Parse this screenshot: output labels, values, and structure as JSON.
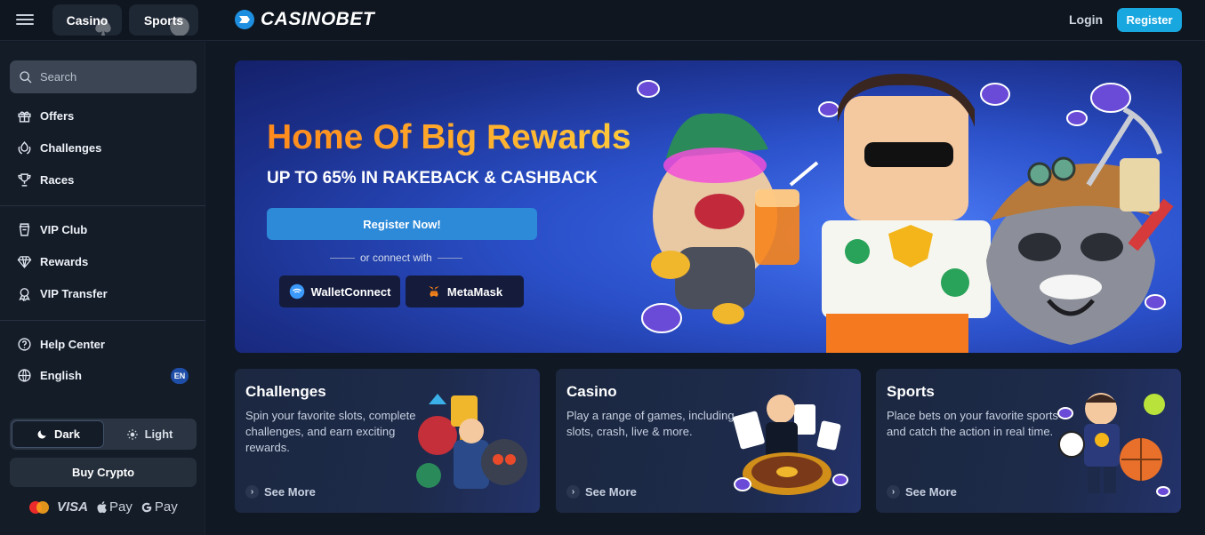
{
  "topbar": {
    "tabs": [
      {
        "label": "Casino"
      },
      {
        "label": "Sports"
      }
    ],
    "logo_text": "CASINOBET",
    "login_label": "Login",
    "register_label": "Register"
  },
  "sidebar": {
    "search_placeholder": "Search",
    "groups": [
      [
        {
          "label": "Offers",
          "icon": "gift-icon"
        },
        {
          "label": "Challenges",
          "icon": "challenges-icon"
        },
        {
          "label": "Races",
          "icon": "trophy-icon"
        }
      ],
      [
        {
          "label": "VIP Club",
          "icon": "vip-icon"
        },
        {
          "label": "Rewards",
          "icon": "diamond-icon"
        },
        {
          "label": "VIP Transfer",
          "icon": "transfer-icon"
        }
      ],
      [
        {
          "label": "Help Center",
          "icon": "help-icon"
        },
        {
          "label": "English",
          "icon": "globe-icon"
        }
      ]
    ],
    "language_badge": "EN",
    "theme": {
      "dark_label": "Dark",
      "light_label": "Light",
      "selected": "Dark"
    },
    "buy_crypto_label": "Buy Crypto",
    "payments": {
      "visa": "VISA",
      "apple_pay": "Pay",
      "google_pay": "Pay"
    }
  },
  "hero": {
    "title": "Home Of Big Rewards",
    "subtitle": "UP TO 65% IN RAKEBACK & CASHBACK",
    "register_label": "Register Now!",
    "connect_label": "or connect with",
    "wallets": [
      {
        "label": "WalletConnect",
        "icon": "walletconnect-icon"
      },
      {
        "label": "MetaMask",
        "icon": "metamask-icon"
      }
    ]
  },
  "cards": [
    {
      "title": "Challenges",
      "description": "Spin your favorite slots, complete challenges, and earn exciting rewards.",
      "more_label": "See More"
    },
    {
      "title": "Casino",
      "description": "Play a range of games, including slots, crash, live & more.",
      "more_label": "See More"
    },
    {
      "title": "Sports",
      "description": "Place bets on your favorite sports and catch the action in real time.",
      "more_label": "See More"
    }
  ],
  "colors": {
    "accent": "#19a7e0",
    "hero_title_start": "#ff8a1c",
    "hero_title_end": "#ffc93a",
    "background": "#101824"
  }
}
